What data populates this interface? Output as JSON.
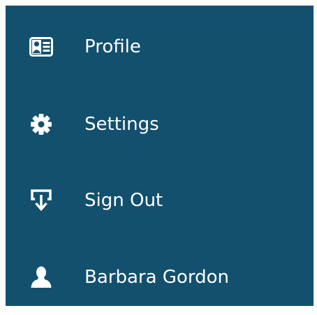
{
  "menu": {
    "background": "#12506e",
    "text_color": "#ffffff",
    "items": [
      {
        "label": "Profile",
        "icon": "id-card-icon"
      },
      {
        "label": "Settings",
        "icon": "gear-icon"
      },
      {
        "label": "Sign Out",
        "icon": "sign-out-icon"
      },
      {
        "label": "Barbara Gordon",
        "icon": "user-icon"
      }
    ]
  }
}
